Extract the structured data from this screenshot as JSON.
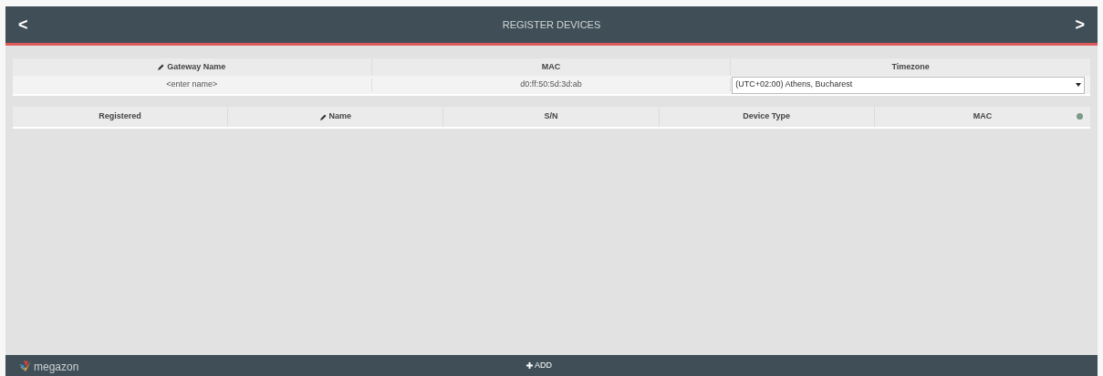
{
  "header": {
    "back": "<",
    "title": "REGISTER DEVICES",
    "next": ">"
  },
  "gateway": {
    "columns": [
      {
        "label": "Gateway Name",
        "editable": true
      },
      {
        "label": "MAC",
        "editable": false
      },
      {
        "label": "Timezone",
        "editable": false
      }
    ],
    "name_placeholder": "<enter name>",
    "mac": "d0:ff:50:5d:3d:ab",
    "timezone": "(UTC+02:00) Athens, Bucharest"
  },
  "devices": {
    "columns": [
      {
        "label": "Registered",
        "editable": false
      },
      {
        "label": "Name",
        "editable": true
      },
      {
        "label": "S/N",
        "editable": false
      },
      {
        "label": "Device Type",
        "editable": false
      },
      {
        "label": "MAC",
        "editable": false
      }
    ]
  },
  "footer": {
    "brand": "megazon",
    "add": "ADD"
  }
}
